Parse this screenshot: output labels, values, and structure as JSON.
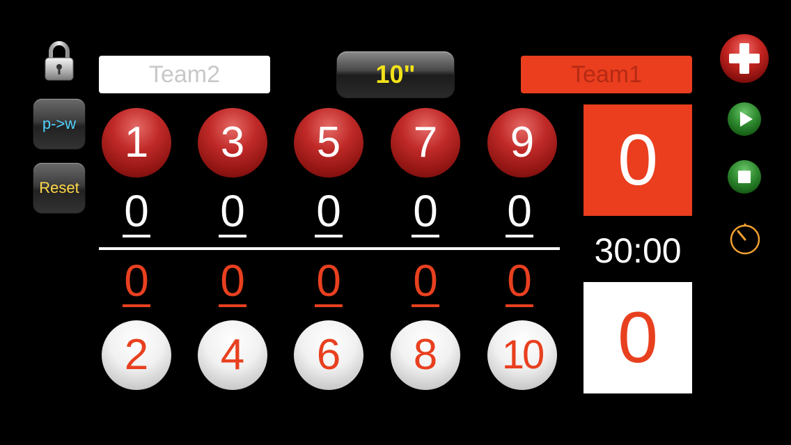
{
  "toolbar": {
    "lock_icon": "padlock-icon",
    "mode_label": "p->w",
    "reset_label": "Reset"
  },
  "teams": {
    "left_name": "Team2",
    "right_name": "Team1"
  },
  "shot_clock": "10\"",
  "game_clock": "30:00",
  "totals": {
    "top": "0",
    "bottom": "0"
  },
  "columns": [
    {
      "red_ball": "1",
      "top_score": "0",
      "bottom_score": "0",
      "white_ball": "2"
    },
    {
      "red_ball": "3",
      "top_score": "0",
      "bottom_score": "0",
      "white_ball": "4"
    },
    {
      "red_ball": "5",
      "top_score": "0",
      "bottom_score": "0",
      "white_ball": "6"
    },
    {
      "red_ball": "7",
      "top_score": "0",
      "bottom_score": "0",
      "white_ball": "8"
    },
    {
      "red_ball": "9",
      "top_score": "0",
      "bottom_score": "0",
      "white_ball": "10"
    }
  ],
  "controls": {
    "add_icon": "plus-icon",
    "play_icon": "play-icon",
    "stop_icon": "stop-icon",
    "timer_icon": "stopwatch-icon"
  },
  "colors": {
    "accent_red": "#ea3e1e",
    "shot_clock_text": "#f2e21a",
    "mode_text": "#4fd3ff",
    "reset_text": "#ffd84a",
    "control_green": "#2f8a2f",
    "timer_orange": "#f0a030"
  }
}
